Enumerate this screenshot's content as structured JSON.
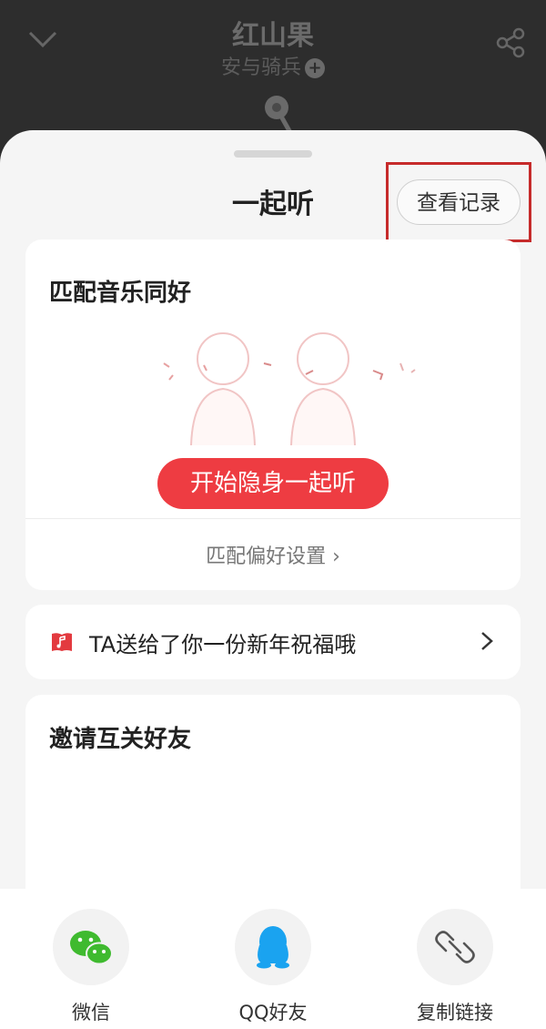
{
  "player": {
    "song_title": "红山果",
    "artist": "安与骑兵",
    "plus": "+"
  },
  "sheet": {
    "title": "一起听",
    "history_button": "查看记录"
  },
  "match_card": {
    "heading": "匹配音乐同好",
    "start_button": "开始隐身一起听",
    "preference_link": "匹配偏好设置 ›"
  },
  "gift_card": {
    "text": "TA送给了你一份新年祝福哦"
  },
  "invite_card": {
    "heading": "邀请互关好友"
  },
  "share": {
    "items": [
      {
        "label": "微信",
        "icon": "wechat-icon"
      },
      {
        "label": "QQ好友",
        "icon": "qq-icon"
      },
      {
        "label": "复制链接",
        "icon": "link-icon"
      }
    ]
  },
  "colors": {
    "accent": "#ee3c42",
    "highlight_box": "#c62b2b"
  }
}
